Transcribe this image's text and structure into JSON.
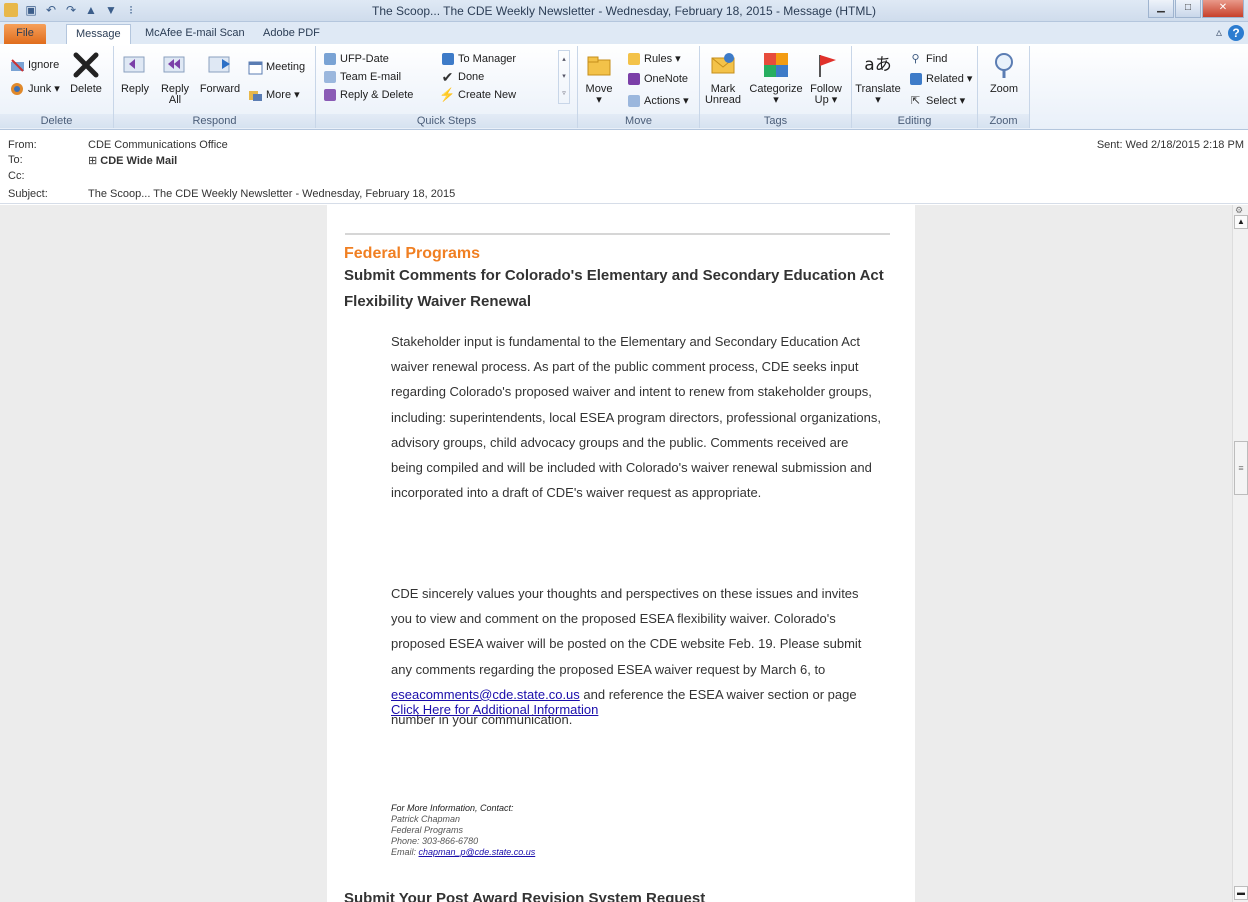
{
  "window": {
    "title": "The Scoop... The CDE Weekly Newsletter - Wednesday, February 18, 2015 - Message (HTML)"
  },
  "tabs": [
    "File",
    "Message",
    "McAfee E-mail Scan",
    "Adobe PDF"
  ],
  "ribbon": {
    "delete": {
      "ignore": "Ignore",
      "junk": "Junk",
      "delete": "Delete",
      "label": "Delete"
    },
    "respond": {
      "reply": "Reply",
      "reply_all_1": "Reply",
      "reply_all_2": "All",
      "forward": "Forward",
      "meeting": "Meeting",
      "more": "More",
      "label": "Respond"
    },
    "quick_steps": {
      "items": [
        "UFP-Date",
        "Team E-mail",
        "Reply & Delete",
        "To Manager",
        "Done",
        "Create New"
      ],
      "label": "Quick Steps"
    },
    "move": {
      "move": "Move",
      "rules": "Rules",
      "onenote": "OneNote",
      "actions": "Actions",
      "label": "Move"
    },
    "tags": {
      "mark_unread_1": "Mark",
      "mark_unread_2": "Unread",
      "categorize": "Categorize",
      "follow_up_1": "Follow",
      "follow_up_2": "Up",
      "label": "Tags"
    },
    "editing": {
      "translate": "Translate",
      "find": "Find",
      "related": "Related",
      "select": "Select",
      "label": "Editing"
    },
    "zoom": {
      "zoom": "Zoom",
      "label": "Zoom"
    }
  },
  "header": {
    "from_label": "From:",
    "from_value": "CDE Communications Office",
    "to_label": "To:",
    "to_value": "CDE Wide Mail",
    "cc_label": "Cc:",
    "subject_label": "Subject:",
    "subject_value": "The Scoop... The CDE Weekly Newsletter - Wednesday, February 18, 2015",
    "sent": "Sent:  Wed 2/18/2015 2:18 PM"
  },
  "email": {
    "section": "Federal Programs",
    "heading": "Submit Comments for Colorado's Elementary and Secondary Education Act Flexibility Waiver Renewal",
    "para1": "Stakeholder input is fundamental to the Elementary and Secondary Education Act waiver renewal process. As part of the public comment process, CDE seeks input regarding Colorado's proposed waiver and intent to renew from stakeholder groups, including: superintendents, local ESEA program directors, professional organizations, advisory groups, child advocacy groups and the public. Comments received are being compiled and will be included with Colorado's waiver renewal submission and incorporated into a draft of CDE's waiver request as appropriate.",
    "para2_a": "CDE sincerely values your thoughts and perspectives on these issues and invites you to view and comment on the proposed ESEA flexibility waiver. Colorado's proposed ESEA waiver will be posted on the CDE website Feb. 19. Please submit any comments regarding the proposed ESEA waiver request by March 6, to ",
    "para2_email": "eseacomments@cde.state.co.us",
    "para2_b": " and reference the ESEA waiver section or page number in your communication.",
    "more_info_link": "Click Here for Additional Information",
    "contact_head": "For More Information, Contact:",
    "contact_name": "Patrick Chapman",
    "contact_dept": "Federal Programs",
    "contact_phone": "Phone: 303-866-6780",
    "contact_email_label": "Email: ",
    "contact_email": "chapman_p@cde.state.co.us",
    "next_heading": "Submit Your Post Award Revision System Request"
  }
}
